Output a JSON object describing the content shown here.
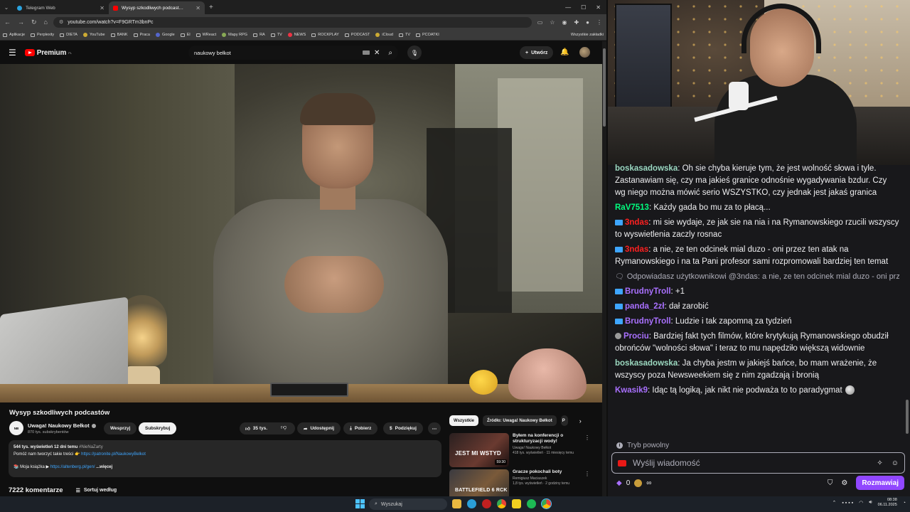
{
  "browser": {
    "tabs": [
      {
        "title": "Telegram Web",
        "color": "#2aa3e0",
        "active": false
      },
      {
        "title": "Wysyp szkodliwych podcast…",
        "color": "#ff0000",
        "active": true
      }
    ],
    "url": "youtube.com/watch?v=F9GRTm3bnPc",
    "bookmarks": [
      "Aplikacje",
      "Perplexity",
      "DIETA",
      "YouTube",
      "BANK",
      "Praca",
      "Google",
      "El",
      "WReact",
      "Mapy RPG",
      "RA",
      "TV",
      "NEWS",
      "ROCKPLAY",
      "PODCAST",
      "iCloud",
      "TV",
      "PCOATKI"
    ],
    "all_bookmarks": "Wszystkie zakładki"
  },
  "youtube": {
    "logo": "Premium",
    "logo_region": "PL",
    "search_query": "naukowy bełkot",
    "create_label": "Utwórz",
    "video": {
      "title": "Wysyp szkodliwych podcastów",
      "channel": "Uwaga! Naukowy Bełkot",
      "channel_logo": "NB",
      "subscribers": "870 tys. subskrybentów",
      "support_label": "Wesprzyj",
      "subscribe_label": "Subskrybuj",
      "likes": "35 tys.",
      "share_label": "Udostępnij",
      "download_label": "Pobierz",
      "thanks_label": "Podziękuj",
      "views_line": "544 tys. wyświetleń  12 dni temu",
      "hashtag": "#NieNaZarty",
      "desc_line1": "Pomóż nam tworzyć takie treści 👉 ",
      "desc_link1": "https://patronite.pl/NaukowyBelkot",
      "desc_line2": "📚 Moja książka ▶ ",
      "desc_link2": "https://altenberg.pl/gen/",
      "more_label": "...więcej",
      "comment_count": "7222 komentarze",
      "sort_label": "Sortuj według"
    },
    "chips": [
      "Wszystkie",
      "Źródło: Uwaga! Naukowy Bełkot",
      "P"
    ],
    "recommendations": [
      {
        "title": "Byłem na konferencji o strukturyzacji wody!",
        "channel": "Uwaga! Naukowy Bełkot",
        "meta": "418 tys. wyświetleń · 11 miesięcy temu",
        "duration": "59:30",
        "thumb_text": "JEST MI WSTYD"
      },
      {
        "title": "Gracze pokochali boty",
        "channel": "Remigiusz Maciaszek",
        "meta": "1,8 tys. wyświetleń · 2 godziny temu",
        "duration": "",
        "thumb_text": "BATTLEFIELD 6 RCK"
      }
    ]
  },
  "chat": {
    "messages": [
      {
        "user": "boskasadowska",
        "color": "#9cd9c0",
        "badge": "",
        "text": ": Oh sie chyba kieruje tym, że jest wolność słowa i tyle. Zastanawiam się, czy ma jakieś granice odnośnie wygadywania bzdur. Czy wg niego można mówić serio WSZYSTKO, czy jednak jest jakaś granica"
      },
      {
        "user": "RaV7513",
        "color": "#00ff7f",
        "badge": "",
        "text": ": Każdy gada bo mu za to płacą..."
      },
      {
        "user": "3ndas",
        "color": "#ff2020",
        "badge": "yt",
        "text": ": mi sie wydaje, ze jak sie na nia i na Rymanowskiego rzucili wszyscy to wyswietlenia zaczly rosnac"
      },
      {
        "user": "3ndas",
        "color": "#ff2020",
        "badge": "yt",
        "text": ": a nie, ze ten odcinek mial duzo - oni przez ten atak na Rymanowskiego i na ta Pani profesor sami rozpromowali bardziej ten temat"
      },
      {
        "reply": "Odpowiadasz użytkownikowi @3ndas: a nie, ze ten odcinek mial duzo - oni prz..."
      },
      {
        "user": "BrudnyTroll",
        "color": "#a970ff",
        "badge": "yt",
        "text": ": +1"
      },
      {
        "user": "panda_2zł",
        "color": "#a970ff",
        "badge": "yt",
        "text": ": dał zarobić"
      },
      {
        "user": "BrudnyTroll",
        "color": "#a970ff",
        "badge": "yt",
        "text": ": Ludzie i tak zapomną za tydzień"
      },
      {
        "user": "Prociu",
        "color": "#a970ff",
        "badge": "grey",
        "text": ": Bardziej fakt tych filmów, które krytykują Rymanowskiego obudził obrońców \"wolności słowa\" i teraz to mu napędziło większą widownie"
      },
      {
        "user": "boskasadowska",
        "color": "#9cd9c0",
        "badge": "",
        "text": ": Ja chyba jestm w jakiejś bańce, bo mam wrażenie, że wszyscy poza Newsweekiem się z nim zgadzają i bronią"
      },
      {
        "user": "Kwasik9",
        "color": "#a970ff",
        "badge": "",
        "text": ": Idąc tą logiką, jak nikt nie podważa to to paradygmat",
        "emote": true
      }
    ],
    "slow_mode": "Tryb powolny",
    "input_placeholder": "Wyślij wiadomość",
    "points": "0",
    "infinity": "∞",
    "send_button": "Rozmawiaj"
  },
  "taskbar": {
    "search_placeholder": "Wyszukaj",
    "time": "08:38",
    "date": "06.11.2025"
  }
}
